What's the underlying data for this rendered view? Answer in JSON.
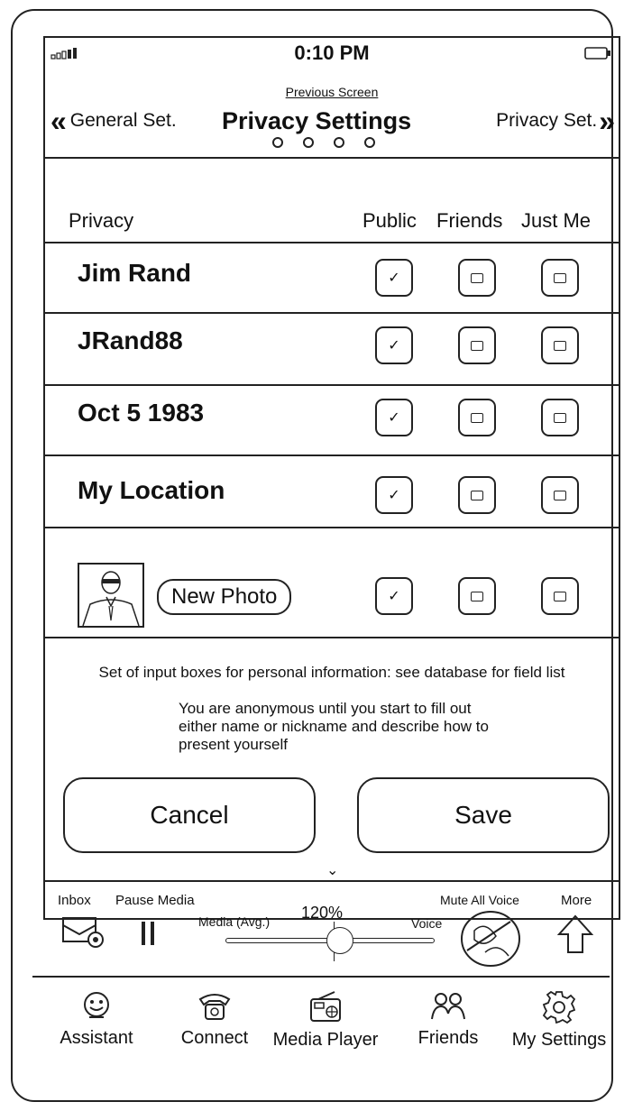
{
  "status": {
    "time": "0:10 PM",
    "signal_icon": "signal-icon",
    "battery_icon": "battery-icon"
  },
  "nav": {
    "previous_screen": "Previous Screen",
    "back_label": "General Set.",
    "title": "Privacy Settings",
    "forward_label": "Privacy Set."
  },
  "columns": {
    "field": "Privacy",
    "public": "Public",
    "friends": "Friends",
    "just_me": "Just Me"
  },
  "rows": [
    {
      "label": "Jim Rand",
      "public": true,
      "friends": false,
      "just_me": false
    },
    {
      "label": "JRand88",
      "public": true,
      "friends": false,
      "just_me": false
    },
    {
      "label": "Oct 5 1983",
      "public": true,
      "friends": false,
      "just_me": false
    },
    {
      "label": "My Location",
      "public": true,
      "friends": false,
      "just_me": false
    }
  ],
  "photo_row": {
    "button": "New Photo",
    "public": true,
    "friends": false,
    "just_me": false
  },
  "notes": {
    "line1": "Set of input boxes for personal information: see database for field list",
    "line2": "You are anonymous until you start to fill out",
    "line3": "either name or nickname and describe how to",
    "line4": "present yourself"
  },
  "buttons": {
    "cancel": "Cancel",
    "save": "Save"
  },
  "media_bar": {
    "inbox": "Inbox",
    "pause_media": "Pause Media",
    "media_avg": "Media (Avg.)",
    "zoom": "120%",
    "voice": "Voice",
    "mute_all_voice": "Mute All Voice",
    "more": "More",
    "slider_level": 0.5
  },
  "tabs": [
    {
      "label": "Assistant",
      "icon": "assistant-icon"
    },
    {
      "label": "Connect",
      "icon": "phone-icon"
    },
    {
      "label": "Media Player",
      "icon": "radio-icon"
    },
    {
      "label": "Friends",
      "icon": "friends-icon"
    },
    {
      "label": "My Settings",
      "icon": "gear-icon"
    }
  ]
}
